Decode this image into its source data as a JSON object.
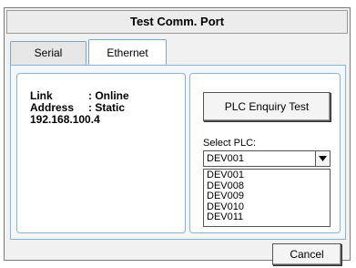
{
  "dialog": {
    "title": "Test Comm. Port"
  },
  "tabs": [
    {
      "label": "Serial",
      "selected": false
    },
    {
      "label": "Ethernet",
      "selected": true
    }
  ],
  "status": {
    "link_key": "Link",
    "link_value": ": Online",
    "address_key": "Address",
    "address_value": ": Static",
    "ip": "192.168.100.4"
  },
  "plc": {
    "enquiry_button": "PLC Enquiry Test",
    "select_label": "Select PLC:",
    "selected": "DEV001",
    "options": [
      "DEV001",
      "DEV008",
      "DEV009",
      "DEV010",
      "DEV011"
    ]
  },
  "footer": {
    "cancel_label": "Cancel"
  }
}
